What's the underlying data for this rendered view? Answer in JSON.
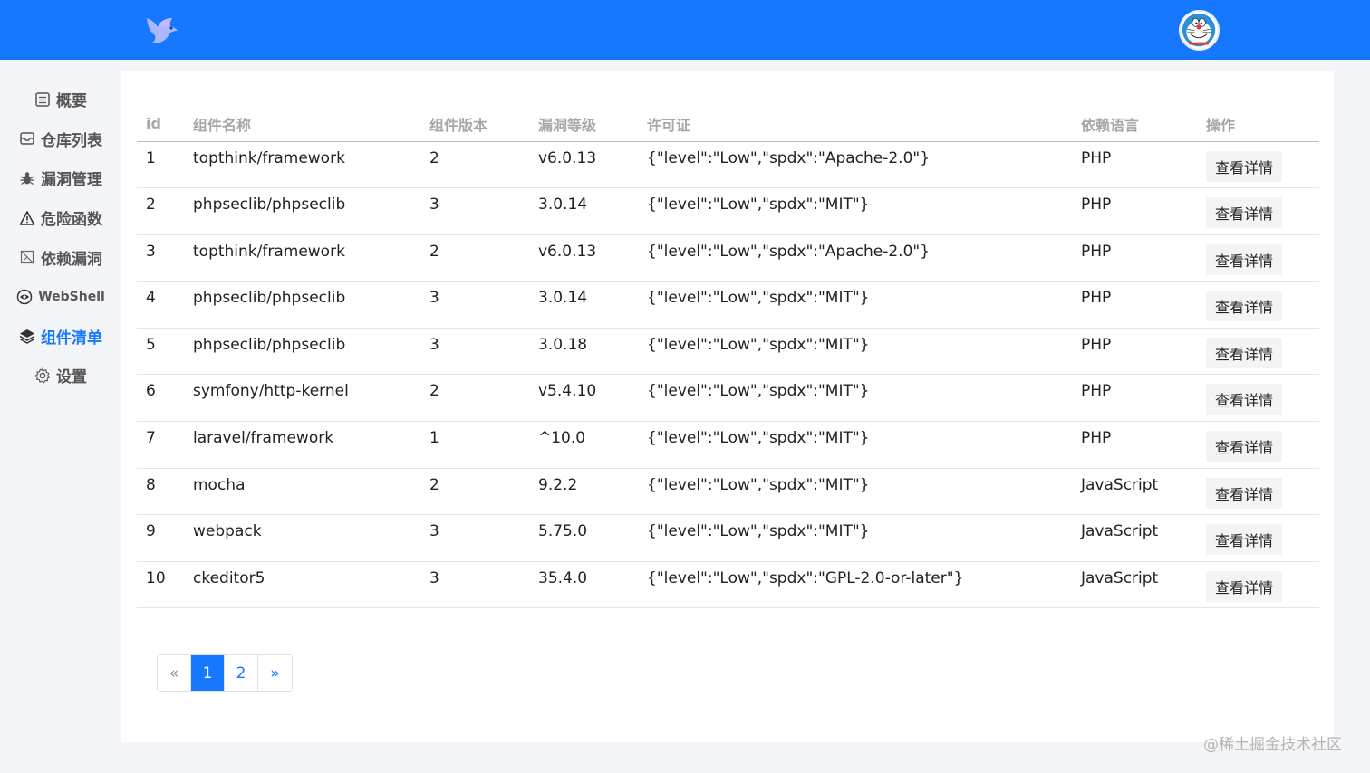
{
  "colors": {
    "primary": "#1677ff",
    "background": "#f3f5f8"
  },
  "header": {
    "logo_icon": "bird-logo-icon",
    "avatar_icon": "doraemon-avatar"
  },
  "sidebar": {
    "items": [
      {
        "label": "概要",
        "icon": "list-icon"
      },
      {
        "label": "仓库列表",
        "icon": "inbox-icon"
      },
      {
        "label": "漏洞管理",
        "icon": "bug-icon"
      },
      {
        "label": "危险函数",
        "icon": "warning-icon"
      },
      {
        "label": "依赖漏洞",
        "icon": "file-slash-icon"
      },
      {
        "label": "WebShell",
        "icon": "eye-icon"
      },
      {
        "label": "组件清单",
        "icon": "layers-icon"
      },
      {
        "label": "设置",
        "icon": "gear-icon"
      }
    ],
    "active": "组件清单"
  },
  "table": {
    "columns": [
      "id",
      "组件名称",
      "组件版本",
      "漏洞等级",
      "许可证",
      "依赖语言",
      "操作"
    ],
    "action_label": "查看详情",
    "rows": [
      {
        "id": "1",
        "name": "topthink/framework",
        "version": "2",
        "level": "v6.0.13",
        "license": "{\"level\":\"Low\",\"spdx\":\"Apache-2.0\"}",
        "language": "PHP"
      },
      {
        "id": "2",
        "name": "phpseclib/phpseclib",
        "version": "3",
        "level": "3.0.14",
        "license": "{\"level\":\"Low\",\"spdx\":\"MIT\"}",
        "language": "PHP"
      },
      {
        "id": "3",
        "name": "topthink/framework",
        "version": "2",
        "level": "v6.0.13",
        "license": "{\"level\":\"Low\",\"spdx\":\"Apache-2.0\"}",
        "language": "PHP"
      },
      {
        "id": "4",
        "name": "phpseclib/phpseclib",
        "version": "3",
        "level": "3.0.14",
        "license": "{\"level\":\"Low\",\"spdx\":\"MIT\"}",
        "language": "PHP"
      },
      {
        "id": "5",
        "name": "phpseclib/phpseclib",
        "version": "3",
        "level": "3.0.18",
        "license": "{\"level\":\"Low\",\"spdx\":\"MIT\"}",
        "language": "PHP"
      },
      {
        "id": "6",
        "name": "symfony/http-kernel",
        "version": "2",
        "level": "v5.4.10",
        "license": "{\"level\":\"Low\",\"spdx\":\"MIT\"}",
        "language": "PHP"
      },
      {
        "id": "7",
        "name": "laravel/framework",
        "version": "1",
        "level": "^10.0",
        "license": "{\"level\":\"Low\",\"spdx\":\"MIT\"}",
        "language": "PHP"
      },
      {
        "id": "8",
        "name": "mocha",
        "version": "2",
        "level": "9.2.2",
        "license": "{\"level\":\"Low\",\"spdx\":\"MIT\"}",
        "language": "JavaScript"
      },
      {
        "id": "9",
        "name": "webpack",
        "version": "3",
        "level": "5.75.0",
        "license": "{\"level\":\"Low\",\"spdx\":\"MIT\"}",
        "language": "JavaScript"
      },
      {
        "id": "10",
        "name": "ckeditor5",
        "version": "3",
        "level": "35.4.0",
        "license": "{\"level\":\"Low\",\"spdx\":\"GPL-2.0-or-later\"}",
        "language": "JavaScript"
      }
    ]
  },
  "pagination": {
    "prev": "«",
    "pages": [
      "1",
      "2"
    ],
    "current": "1",
    "next": "»"
  },
  "watermark": "@稀土掘金技术社区"
}
